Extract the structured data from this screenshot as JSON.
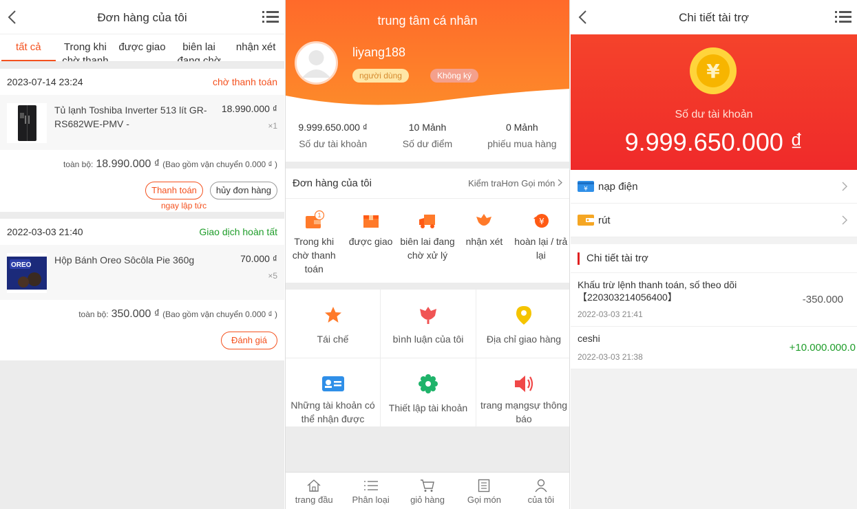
{
  "orders": {
    "title": "Đơn hàng của tôi",
    "tabs": [
      "tất cả",
      "Trong khi chờ thanh toán",
      "được giao",
      "biên lai đang chờ xử lý",
      "nhận xét"
    ],
    "list": [
      {
        "date": "2023-07-14 23:24",
        "status": "chờ thanh toán",
        "product": "Tủ lạnh Toshiba Inverter 513 lít GR-RS682WE-PMV -",
        "price": "18.990.000 ₫",
        "qty": "×1",
        "total_label": "toàn bộ:",
        "total": "18.990.000 ₫",
        "shipping": "(Bao gồm vận chuyển 0.000 ₫ )",
        "btn1": "Thanh toán",
        "btn2": "hủy đơn hàng",
        "note": "ngay lập tức"
      },
      {
        "date": "2022-03-03 21:40",
        "status": "Giao dịch hoàn tất",
        "product": "Hộp Bánh Oreo Sôcôla Pie 360g",
        "price": "70.000 ₫",
        "qty": "×5",
        "total_label": "toàn bộ:",
        "total": "350.000 ₫",
        "shipping": "(Bao gồm vận chuyển 0.000 ₫ )",
        "btn1": "Đánh giá"
      }
    ]
  },
  "profile": {
    "title": "trung tâm cá nhân",
    "username": "liyang188",
    "pill1": "người dùng",
    "pill2": "Không ký",
    "stats": [
      {
        "value": "9.999.650.000 ₫",
        "label": "Số dư tài khoản"
      },
      {
        "value": "10 Mảnh",
        "label": "Số dư điểm"
      },
      {
        "value": "0 Mảnh",
        "label": "phiếu mua hàng"
      }
    ],
    "my_orders": "Đơn hàng của tôi",
    "check_more": "Kiểm traHơn Gọi món",
    "order_icons": [
      {
        "label": "Trong khi chờ thanh toán",
        "badge": "1"
      },
      {
        "label": "được giao"
      },
      {
        "label": "biên lai đang chờ xử lý"
      },
      {
        "label": "nhận xét"
      },
      {
        "label": "hoàn lại / trả lại"
      }
    ],
    "grid": [
      "Tái chế",
      "bình luận của tôi",
      "Địa chỉ giao hàng",
      "Những tài khoản có thể nhận được",
      "Thiết lập tài khoản",
      "trang mạngsự thông báo"
    ],
    "nav": [
      "trang đầu",
      "Phân loại",
      "giỏ hàng",
      "Gọi món",
      "của tôi"
    ]
  },
  "funding": {
    "title": "Chi tiết tài trợ",
    "balance_label": "Số dư tài khoản",
    "balance": "9.999.650.000 ₫",
    "coin_symbol": "¥",
    "row1": "nạp điện",
    "row2": "rút",
    "section": "Chi tiết tài trợ",
    "transactions": [
      {
        "desc": "Khấu trừ lệnh thanh toán, số theo dõi【220303214056400】",
        "time": "2022-03-03 21:41",
        "amount": "-350.000"
      },
      {
        "desc": "ceshi",
        "time": "2022-03-03 21:38",
        "amount": "+10.000.000.0"
      }
    ]
  }
}
